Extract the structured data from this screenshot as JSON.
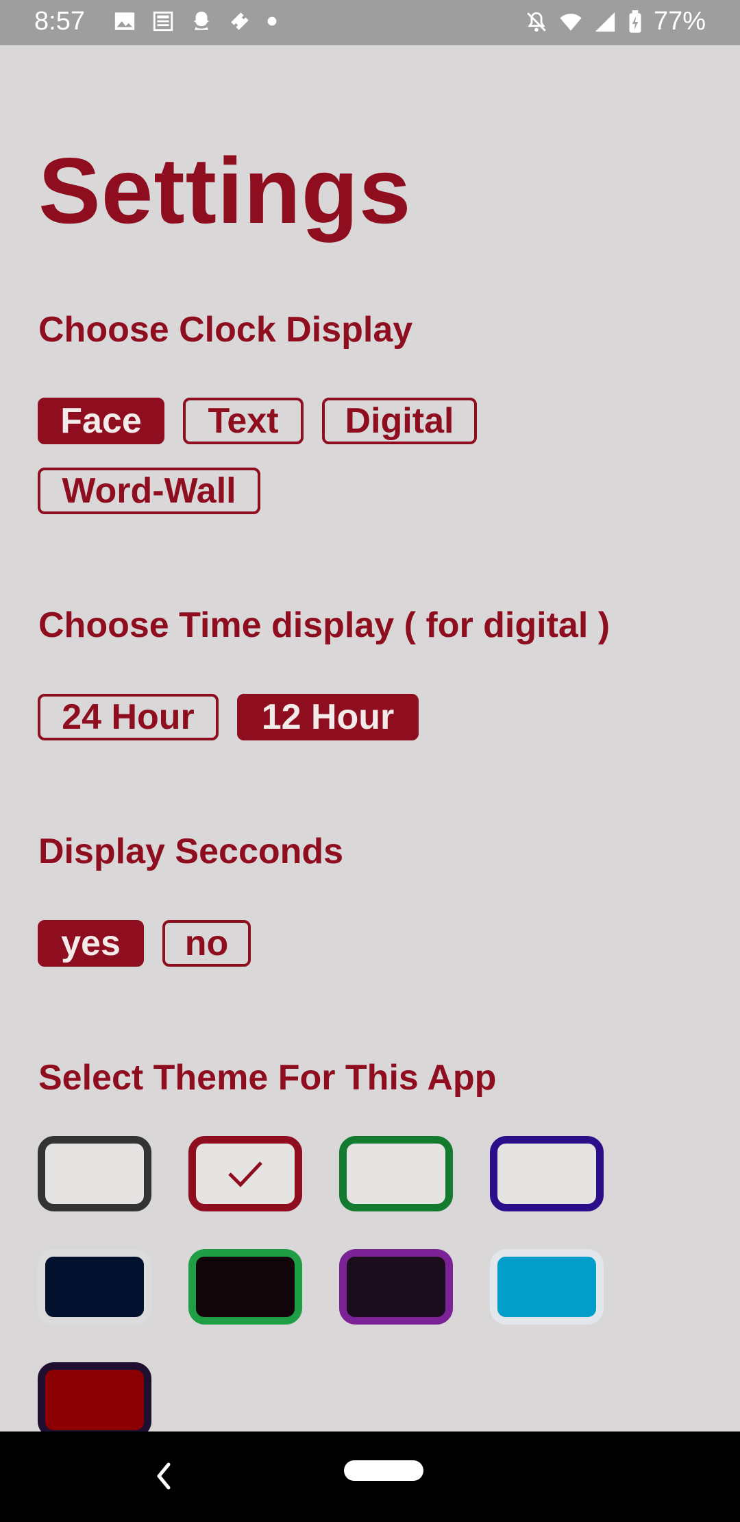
{
  "status_bar": {
    "time": "8:57",
    "left_icons": [
      "image-icon",
      "news-icon",
      "snapchat-icon",
      "ticket-icon",
      "dot-icon"
    ],
    "right_icons": [
      "notifications-off-icon",
      "wifi-icon",
      "signal-icon",
      "battery-charging-icon"
    ],
    "battery": "77%"
  },
  "page": {
    "title": "Settings"
  },
  "clock_display": {
    "heading": "Choose Clock Display",
    "options": [
      "Face",
      "Text",
      "Digital",
      "Word-Wall"
    ],
    "selected": "Face"
  },
  "time_display": {
    "heading": "Choose Time display ( for digital )",
    "options": [
      "24 Hour",
      "12 Hour"
    ],
    "selected": "12 Hour"
  },
  "display_seconds": {
    "heading": "Display Secconds",
    "options": [
      "yes",
      "no"
    ],
    "selected": "yes"
  },
  "theme": {
    "heading": "Select Theme For This App",
    "selected_index": 1,
    "swatches": [
      {
        "border": "#333333",
        "fill": "#e6e3e3"
      },
      {
        "border": "#8e0e1f",
        "fill": "#e6e3e3"
      },
      {
        "border": "#137a2f",
        "fill": "#e6e3e3"
      },
      {
        "border": "#2b0f8a",
        "fill": "#e6e3e3"
      },
      {
        "border": "#dcdcdc",
        "fill": "#01112e"
      },
      {
        "border": "#1f9e45",
        "fill": "#12050a"
      },
      {
        "border": "#7b2396",
        "fill": "#1c0d1d"
      },
      {
        "border": "#e3e7eb",
        "fill": "#029ec9"
      },
      {
        "border": "#1e0f31",
        "fill": "#8b0003"
      }
    ]
  },
  "nav_bar": {
    "icons": [
      "back-icon",
      "home-pill-icon"
    ]
  },
  "colors": {
    "accent": "#8e0e1f",
    "background": "#d9d7d7",
    "status_bar": "#9e9e9e"
  }
}
